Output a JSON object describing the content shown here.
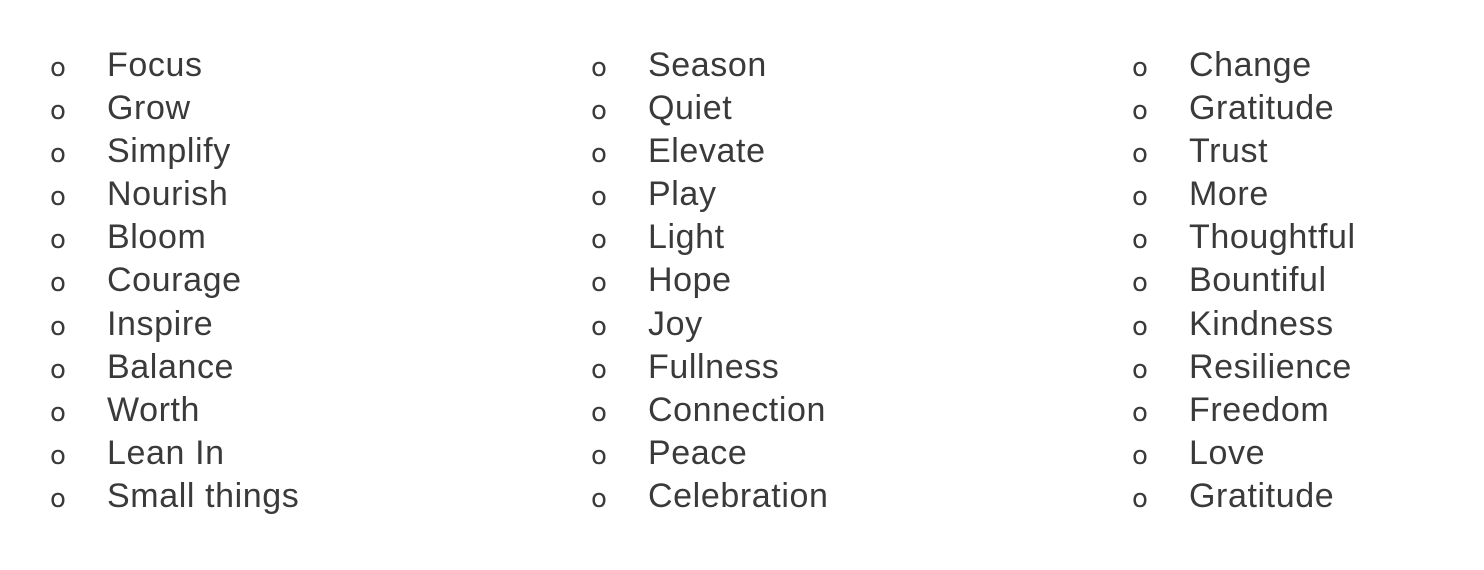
{
  "bullet_glyph": "o",
  "text_color": "#3a3a3a",
  "columns": [
    {
      "items": [
        "Focus",
        "Grow",
        "Simplify",
        "Nourish",
        "Bloom",
        "Courage",
        "Inspire",
        "Balance",
        "Worth",
        "Lean In",
        "Small things"
      ]
    },
    {
      "items": [
        "Season",
        "Quiet",
        "Elevate",
        "Play",
        "Light",
        "Hope",
        "Joy",
        "Fullness",
        "Connection",
        "Peace",
        "Celebration"
      ]
    },
    {
      "items": [
        "Change",
        "Gratitude",
        "Trust",
        "More",
        "Thoughtful",
        "Bountiful",
        "Kindness",
        "Resilience",
        "Freedom",
        "Love",
        "Gratitude"
      ]
    }
  ]
}
